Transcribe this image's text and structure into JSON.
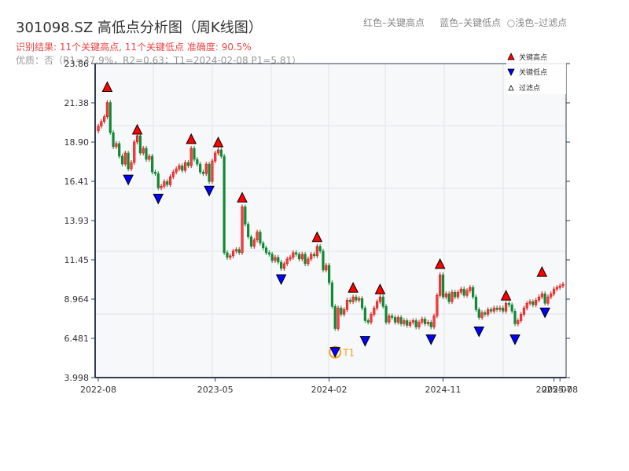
{
  "header": {
    "title": "301098.SZ 高低点分析图（周K线图）",
    "result": "识别结果: 11个关键高点, 11个关键低点   准确度: 90.5%",
    "quality": "优质：否（R1=37.9%，R2=0.63；T1=2024-02-08 P1=5.81）",
    "hint_high": "红色–关键高点",
    "hint_low": "蓝色–关键低点",
    "hint_filtered": "○浅色–过滤点"
  },
  "colors": {
    "up": "#dd1111",
    "down": "#118833",
    "high": "#ff0000",
    "low": "#0000ff",
    "t1": "#f5a020",
    "axis": "#2e3e50",
    "grid": "#e0e4ea",
    "plot_bg": "#f7f8fa"
  },
  "chart_data": {
    "type": "candlestick",
    "title": "301098.SZ 高低点分析图（周K线图）",
    "ylim": [
      3.998,
      23.86
    ],
    "yticks": [
      "23.86",
      "21.38",
      "18.90",
      "16.41",
      "13.93",
      "11.45",
      "8.964",
      "6.481",
      "3.998"
    ],
    "xticks": [
      {
        "label": "2022-08",
        "i": 0
      },
      {
        "label": "2023-05",
        "i": 39
      },
      {
        "label": "2024-02",
        "i": 77
      },
      {
        "label": "2024-11",
        "i": 115
      },
      {
        "label": "2025-07",
        "i": 152
      },
      {
        "label": "2025-08",
        "i": 154
      }
    ],
    "legend": {
      "position": "top-right",
      "items": [
        "关键高点",
        "关键低点",
        "过滤点"
      ]
    },
    "closes": [
      19.9,
      20.2,
      20.5,
      21.4,
      19.5,
      18.6,
      18.8,
      18.0,
      17.5,
      18.2,
      17.2,
      17.6,
      18.9,
      19.3,
      18.2,
      18.5,
      17.8,
      18.0,
      17.0,
      16.9,
      16.0,
      16.1,
      16.4,
      16.2,
      16.7,
      17.0,
      17.2,
      17.4,
      17.1,
      17.6,
      17.4,
      18.5,
      17.8,
      17.5,
      17.0,
      16.9,
      17.5,
      16.4,
      17.7,
      18.2,
      18.4,
      18.0,
      11.9,
      11.6,
      11.7,
      12.0,
      12.1,
      11.9,
      14.8,
      13.7,
      12.9,
      12.3,
      12.7,
      13.2,
      12.5,
      12.2,
      11.9,
      11.8,
      11.4,
      11.6,
      11.3,
      10.9,
      11.2,
      11.5,
      11.6,
      11.9,
      11.8,
      11.5,
      11.8,
      11.2,
      11.5,
      11.8,
      11.7,
      12.3,
      12.0,
      10.8,
      11.1,
      10.0,
      8.5,
      7.1,
      8.4,
      8.0,
      8.3,
      8.9,
      8.8,
      9.1,
      8.9,
      9.0,
      8.4,
      7.6,
      7.5,
      8.0,
      8.4,
      8.8,
      9.1,
      8.5,
      7.5,
      7.9,
      7.8,
      7.5,
      7.8,
      7.4,
      7.6,
      7.3,
      7.5,
      7.6,
      7.2,
      7.5,
      7.7,
      7.4,
      7.5,
      7.2,
      7.9,
      9.2,
      10.5,
      9.1,
      9.3,
      8.8,
      9.4,
      9.1,
      9.4,
      9.6,
      9.2,
      9.5,
      9.7,
      9.1,
      8.3,
      7.8,
      8.1,
      8.0,
      8.3,
      8.2,
      8.4,
      8.3,
      8.4,
      8.2,
      8.7,
      8.6,
      8.2,
      7.4,
      7.6,
      8.0,
      8.4,
      8.7,
      8.8,
      8.6,
      8.9,
      9.1,
      9.3,
      8.7,
      9.1,
      9.3,
      9.6,
      9.7,
      9.8,
      9.9
    ],
    "first_open": 19.6,
    "markers": [
      {
        "i": 3,
        "type": "high",
        "price": 22.0
      },
      {
        "i": 10,
        "type": "low",
        "price": 16.9
      },
      {
        "i": 13,
        "type": "high",
        "price": 19.3
      },
      {
        "i": 20,
        "type": "low",
        "price": 15.7
      },
      {
        "i": 31,
        "type": "high",
        "price": 18.7
      },
      {
        "i": 37,
        "type": "low",
        "price": 16.2
      },
      {
        "i": 40,
        "type": "high",
        "price": 18.5
      },
      {
        "i": 48,
        "type": "high",
        "price": 15.0
      },
      {
        "i": 61,
        "type": "low",
        "price": 10.6
      },
      {
        "i": 73,
        "type": "high",
        "price": 12.5
      },
      {
        "i": 79,
        "type": "low",
        "price": 6.0,
        "label": "T1"
      },
      {
        "i": 85,
        "type": "high",
        "price": 9.3
      },
      {
        "i": 89,
        "type": "low",
        "price": 6.7
      },
      {
        "i": 94,
        "type": "high",
        "price": 9.2
      },
      {
        "i": 111,
        "type": "low",
        "price": 6.8
      },
      {
        "i": 114,
        "type": "high",
        "price": 10.8
      },
      {
        "i": 127,
        "type": "low",
        "price": 7.3
      },
      {
        "i": 136,
        "type": "high",
        "price": 8.8
      },
      {
        "i": 139,
        "type": "low",
        "price": 6.8
      },
      {
        "i": 148,
        "type": "high",
        "price": 10.3
      },
      {
        "i": 149,
        "type": "low",
        "price": 8.5
      }
    ]
  }
}
